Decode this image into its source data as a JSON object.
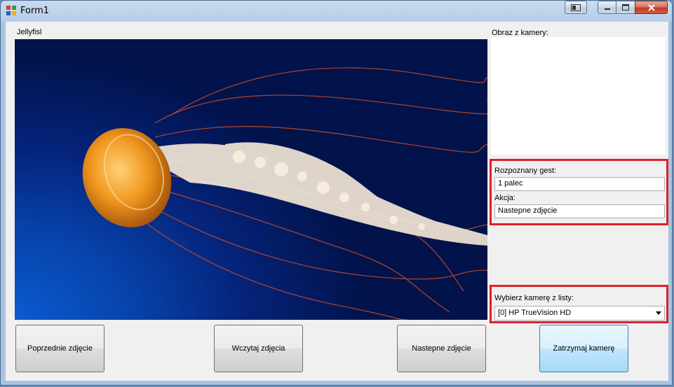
{
  "window": {
    "title": "Form1",
    "icons": {
      "app": "app-form-icon",
      "extra": "window-extra-icon",
      "minimize": "minimize-icon",
      "maximize": "maximize-icon",
      "close": "close-icon"
    }
  },
  "main": {
    "image_label": "Jellyfisl",
    "camera_label": "Obraz z kamery:"
  },
  "gesture": {
    "recognized_label": "Rozpoznany gest:",
    "recognized_value": "1 palec",
    "action_label": "Akcja:",
    "action_value": "Nastepne zdjęcie"
  },
  "camera_select": {
    "label": "Wybierz kamerę z listy:",
    "selected": "[0] HP TrueVision HD",
    "arrow_icon": "chevron-down-icon"
  },
  "buttons": {
    "previous": "Poprzednie zdjęcie",
    "load": "Wczytaj zdjęcia",
    "next": "Nastepne zdjęcie",
    "stop_camera": "Zatrzymaj kamerę"
  },
  "colors": {
    "highlight": "#e0202a",
    "focus": "#3c7fb1"
  }
}
